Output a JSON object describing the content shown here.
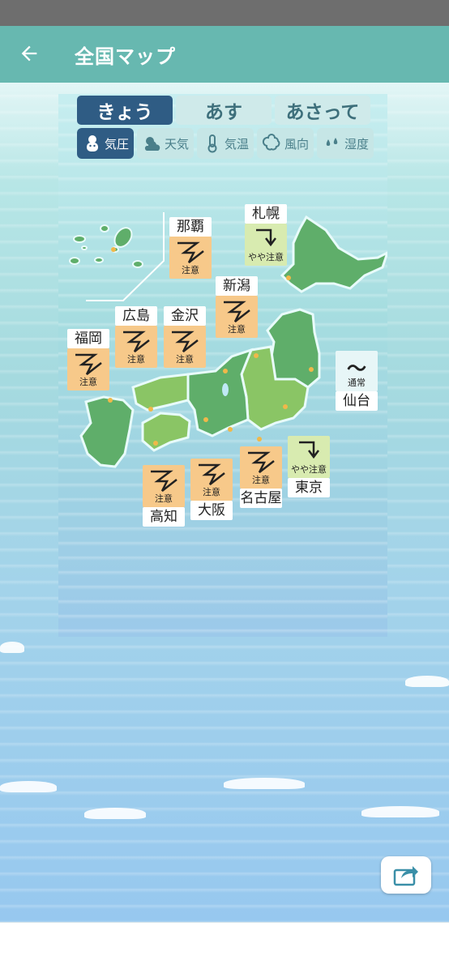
{
  "header": {
    "title": "全国マップ"
  },
  "day_tabs": [
    {
      "label": "きょう",
      "active": true
    },
    {
      "label": "あす",
      "active": false
    },
    {
      "label": "あさって",
      "active": false
    }
  ],
  "category_tabs": [
    {
      "label": "気圧",
      "icon": "pressure-character-icon",
      "active": true
    },
    {
      "label": "天気",
      "icon": "sun-cloud-icon",
      "active": false
    },
    {
      "label": "気温",
      "icon": "thermometer-icon",
      "active": false
    },
    {
      "label": "風向",
      "icon": "wind-icon",
      "active": false
    },
    {
      "label": "湿度",
      "icon": "droplets-icon",
      "active": false
    }
  ],
  "cities": {
    "naha": {
      "name": "那覇",
      "level": "注意"
    },
    "sapporo": {
      "name": "札幌",
      "level": "やや注意"
    },
    "niigata": {
      "name": "新潟",
      "level": "注意"
    },
    "hiroshima": {
      "name": "広島",
      "level": "注意"
    },
    "kanazawa": {
      "name": "金沢",
      "level": "注意"
    },
    "fukuoka": {
      "name": "福岡",
      "level": "注意"
    },
    "sendai": {
      "name": "仙台",
      "level": "通常",
      "symbol": "〜"
    },
    "nagoya": {
      "name": "名古屋",
      "level": "注意"
    },
    "tokyo": {
      "name": "東京",
      "level": "やや注意"
    },
    "kochi": {
      "name": "高知",
      "level": "注意"
    },
    "osaka": {
      "name": "大阪",
      "level": "注意"
    }
  },
  "colors": {
    "appbar": "#67b8b0",
    "active_tab": "#2f5c84",
    "caution": "#f7c98a",
    "mild": "#d8ebb0",
    "land": "#5fae6a"
  }
}
